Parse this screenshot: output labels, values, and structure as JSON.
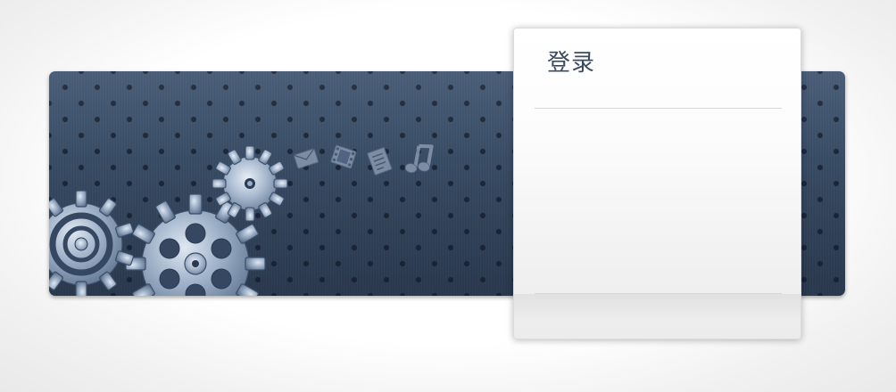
{
  "login": {
    "title": "登录"
  },
  "banner": {
    "background_color": "#354761",
    "hole_color": "#1b2638",
    "gear_metal_color": "#9aaec6",
    "icons": [
      "mail-icon",
      "film-icon",
      "document-icon",
      "music-note-icon"
    ]
  }
}
